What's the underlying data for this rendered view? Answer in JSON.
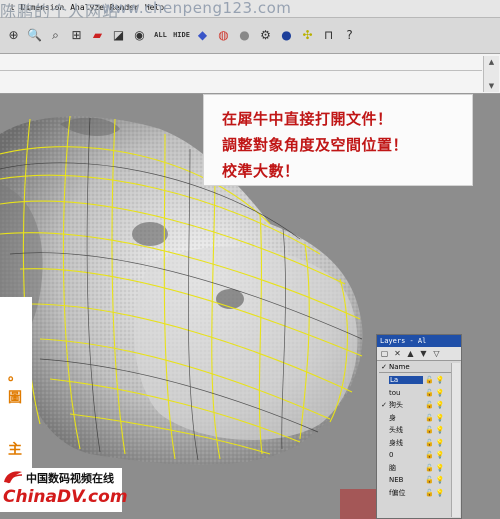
{
  "watermark": {
    "site_name": "陈鹏的个人网站",
    "url": "www.chenpeng123.com"
  },
  "menubar": {
    "items": [
      "t",
      "Dimension",
      "Analyze",
      "Render",
      "Help"
    ]
  },
  "toolbar": {
    "icons": [
      "pan-icon",
      "zoom-icon",
      "zoom-window-icon",
      "zoom-extents-icon",
      "car-icon",
      "shade-icon",
      "eye-icon"
    ],
    "all_label": "ALL",
    "hide_label": "HIDE",
    "icons2": [
      "render-icon",
      "color-wheel-icon",
      "sphere-icon",
      "gear-icon",
      "sphere-blue-icon",
      "globe-icon",
      "grid-icon",
      "help-icon"
    ]
  },
  "command": {
    "input_value": ""
  },
  "note": {
    "line1": "在犀牛中直接打開文件！",
    "line2": "調整對象角度及空間位置！",
    "line3": "校準大數！"
  },
  "left_panel": {
    "fragments": [
      "。",
      "圖",
      "主"
    ]
  },
  "layers_panel": {
    "title": "Layers - Al",
    "column_name": "Name",
    "rows": [
      {
        "name": "La",
        "checked": false,
        "selected": true,
        "bulb": true
      },
      {
        "name": "tou",
        "checked": false,
        "selected": false,
        "bulb": false
      },
      {
        "name": "狗头",
        "checked": true,
        "selected": false,
        "bulb": false
      },
      {
        "name": "身",
        "checked": false,
        "selected": false,
        "bulb": false
      },
      {
        "name": "头线",
        "checked": false,
        "selected": false,
        "bulb": false
      },
      {
        "name": "身线",
        "checked": false,
        "selected": false,
        "bulb": false
      },
      {
        "name": "0",
        "checked": false,
        "selected": false,
        "bulb": false
      },
      {
        "name": "脑",
        "checked": false,
        "selected": false,
        "bulb": true
      },
      {
        "name": "NEB",
        "checked": false,
        "selected": false,
        "bulb": true
      },
      {
        "name": "f偏位",
        "checked": false,
        "selected": false,
        "bulb": true
      }
    ]
  },
  "logo": {
    "cn_text": "中国数码视频在线",
    "en_text": "ChinaDV.com"
  },
  "colors": {
    "wire": "#e8e21a",
    "note_text": "#c01616",
    "titlebar": "#1f4fa8"
  }
}
